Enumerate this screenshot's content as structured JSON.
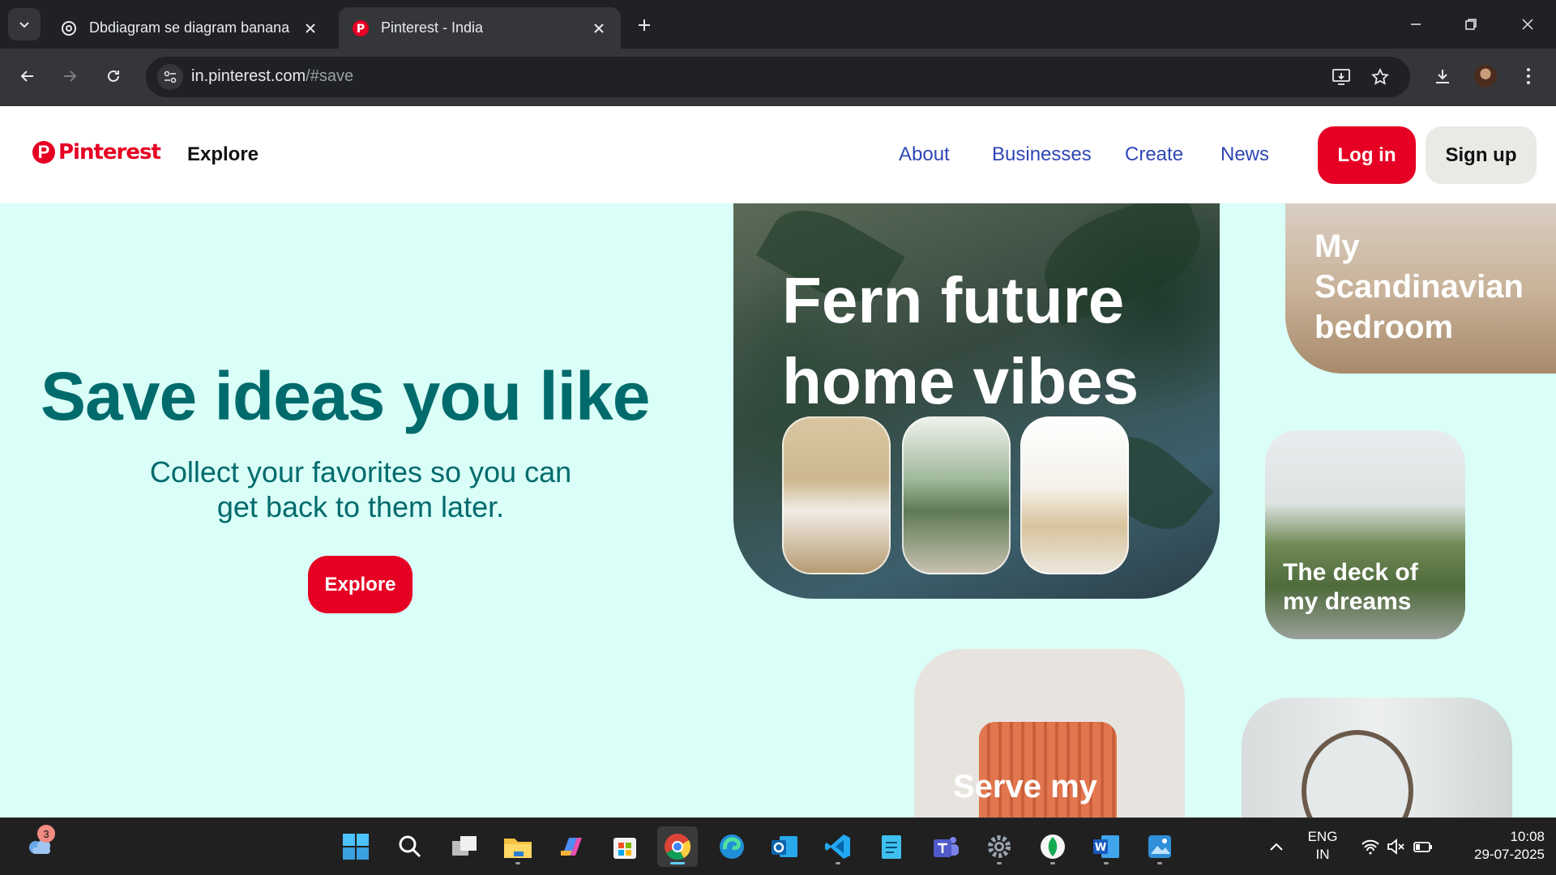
{
  "browser": {
    "tabs": [
      {
        "title": "Dbdiagram se diagram banana",
        "active": false,
        "favicon": "openai-icon"
      },
      {
        "title": "Pinterest - India",
        "active": true,
        "favicon": "pinterest-icon"
      }
    ],
    "address": {
      "host": "in.pinterest.com",
      "path": "/#save"
    }
  },
  "header": {
    "logo_text": "Pinterest",
    "explore_label": "Explore",
    "nav": [
      "About",
      "Businesses",
      "Create",
      "News"
    ],
    "login_label": "Log in",
    "signup_label": "Sign up"
  },
  "hero": {
    "title": "Save ideas you like",
    "subtitle_line1": "Collect your favorites so you can",
    "subtitle_line2": "get back to them later.",
    "cta_label": "Explore"
  },
  "cards": {
    "big_line1": "Fern future",
    "big_line2": "home vibes",
    "scand_line1": "My",
    "scand_line2": "Scandinavian",
    "scand_line3": "bedroom",
    "deck_line1": "The deck of",
    "deck_line2": "my dreams",
    "serve_title": "Serve my"
  },
  "taskbar": {
    "notification_count": "3",
    "lang_line1": "ENG",
    "lang_line2": "IN",
    "time": "10:08",
    "date": "29-07-2025"
  },
  "colors": {
    "brand": "#e60023",
    "hero_text": "#006b6c",
    "nav_link": "#3047b5",
    "hero_bg": "#dafff8"
  }
}
